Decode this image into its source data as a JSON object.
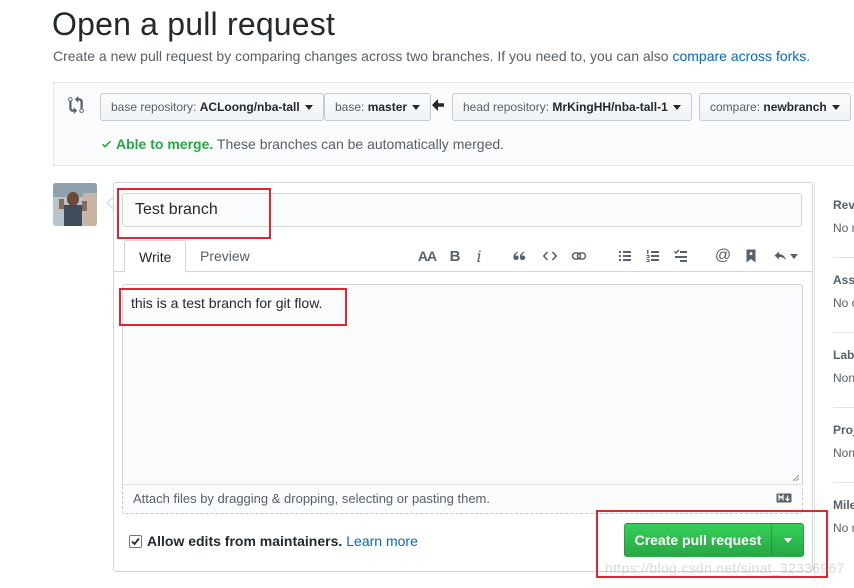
{
  "header": {
    "title": "Open a pull request",
    "subtitle_text": "Create a new pull request by comparing changes across two branches. If you need to, you can also",
    "subtitle_link": "compare across forks",
    "subtitle_end": "."
  },
  "range": {
    "base_repo_label": "base repository:",
    "base_repo_value": "ACLoong/nba-tall",
    "base_branch_label": "base:",
    "base_branch_value": "master",
    "head_repo_label": "head repository:",
    "head_repo_value": "MrKingHH/nba-tall-1",
    "compare_label": "compare:",
    "compare_value": "newbranch",
    "merge_ok": "Able to merge.",
    "merge_text": "These branches can be automatically merged."
  },
  "form": {
    "title_value": "Test branch",
    "tab_write": "Write",
    "tab_preview": "Preview",
    "tool_heading": "AA",
    "tool_bold": "B",
    "tool_italic": "i",
    "tool_mention": "@",
    "body_value": "this is a test branch for git flow.",
    "attach_text": "Attach files by dragging & dropping, selecting or pasting them.",
    "allow_edits_label": "Allow edits from maintainers.",
    "learn_more": "Learn more",
    "create_button": "Create pull request"
  },
  "sidebar": {
    "items": [
      {
        "heading": "Reviewers",
        "value": "No reviews"
      },
      {
        "heading": "Assignees",
        "value": "No one"
      },
      {
        "heading": "Labels",
        "value": "None yet"
      },
      {
        "heading": "Projects",
        "value": "None yet"
      },
      {
        "heading": "Milestone",
        "value": "No milestone"
      }
    ]
  },
  "watermark": "https://blog.csdn.net/sinat_32336967",
  "colors": {
    "accent_link": "#0366d6",
    "merge_ok": "#28a745",
    "create_button": "#2ea44f",
    "highlight": "#e0262e"
  },
  "icons": [
    "compare-icon",
    "arrow-left-icon",
    "check-icon",
    "quote-icon",
    "code-icon",
    "link-icon",
    "unordered-list-icon",
    "ordered-list-icon",
    "task-list-icon",
    "mention-icon",
    "bookmark-icon",
    "reply-icon",
    "markdown-icon",
    "caret-down-icon"
  ]
}
